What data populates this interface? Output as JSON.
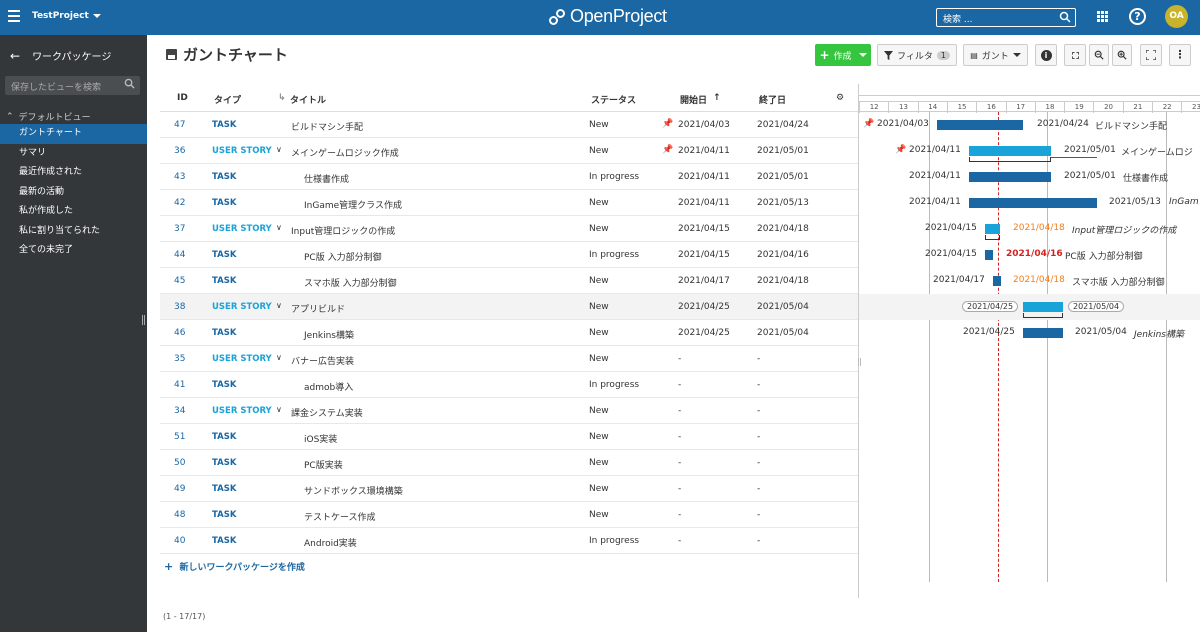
{
  "header": {
    "project": "TestProject",
    "logo": "OpenProject",
    "search_placeholder": "検索 ...",
    "avatar": "OA",
    "brand_color": "#1a67a3"
  },
  "sidebar": {
    "back_label": "ワークパッケージ",
    "search_placeholder": "保存したビューを検索",
    "section": "デフォルトビュー",
    "items": [
      {
        "label": "ガントチャート"
      },
      {
        "label": "サマリ"
      },
      {
        "label": "最近作成された"
      },
      {
        "label": "最新の活動"
      },
      {
        "label": "私が作成した"
      },
      {
        "label": "私に割り当てられた"
      },
      {
        "label": "全ての未完了"
      }
    ]
  },
  "page": {
    "title": "ガントチャート",
    "create": "作成",
    "filter": "フィルタ",
    "filter_count": "1",
    "gantt": "ガント"
  },
  "table": {
    "headers": {
      "id": "ID",
      "type": "タイプ",
      "title": "タイトル",
      "status": "ステータス",
      "start": "開始日",
      "end": "終了日"
    },
    "rows": [
      {
        "id": "47",
        "type": "TASK",
        "title": "ビルドマシン手配",
        "indent": 0,
        "status": "New",
        "start": "2021/04/03",
        "end": "2021/04/24"
      },
      {
        "id": "36",
        "type": "USER STORY",
        "title": "メインゲームロジック作成",
        "indent": 0,
        "status": "New",
        "start": "2021/04/11",
        "end": "2021/05/01"
      },
      {
        "id": "43",
        "type": "TASK",
        "title": "仕様書作成",
        "indent": 1,
        "status": "In progress",
        "start": "2021/04/11",
        "end": "2021/05/01"
      },
      {
        "id": "42",
        "type": "TASK",
        "title": "InGame管理クラス作成",
        "indent": 1,
        "status": "New",
        "start": "2021/04/11",
        "end": "2021/05/13"
      },
      {
        "id": "37",
        "type": "USER STORY",
        "title": "Input管理ロジックの作成",
        "indent": 0,
        "status": "New",
        "start": "2021/04/15",
        "end": "2021/04/18"
      },
      {
        "id": "44",
        "type": "TASK",
        "title": "PC版 入力部分制御",
        "indent": 1,
        "status": "In progress",
        "start": "2021/04/15",
        "end": "2021/04/16"
      },
      {
        "id": "45",
        "type": "TASK",
        "title": "スマホ版 入力部分制御",
        "indent": 1,
        "status": "New",
        "start": "2021/04/17",
        "end": "2021/04/18"
      },
      {
        "id": "38",
        "type": "USER STORY",
        "title": "アプリビルド",
        "indent": 0,
        "status": "New",
        "start": "2021/04/25",
        "end": "2021/05/04"
      },
      {
        "id": "46",
        "type": "TASK",
        "title": "Jenkins構築",
        "indent": 1,
        "status": "New",
        "start": "2021/04/25",
        "end": "2021/05/04"
      },
      {
        "id": "35",
        "type": "USER STORY",
        "title": "バナー広告実装",
        "indent": 0,
        "status": "New",
        "start": "-",
        "end": "-"
      },
      {
        "id": "41",
        "type": "TASK",
        "title": "admob導入",
        "indent": 1,
        "status": "In progress",
        "start": "-",
        "end": "-"
      },
      {
        "id": "34",
        "type": "USER STORY",
        "title": "課金システム実装",
        "indent": 0,
        "status": "New",
        "start": "-",
        "end": "-"
      },
      {
        "id": "51",
        "type": "TASK",
        "title": "iOS実装",
        "indent": 1,
        "status": "New",
        "start": "-",
        "end": "-"
      },
      {
        "id": "50",
        "type": "TASK",
        "title": "PC版実装",
        "indent": 1,
        "status": "New",
        "start": "-",
        "end": "-"
      },
      {
        "id": "49",
        "type": "TASK",
        "title": "サンドボックス環境構築",
        "indent": 1,
        "status": "New",
        "start": "-",
        "end": "-"
      },
      {
        "id": "48",
        "type": "TASK",
        "title": "テストケース作成",
        "indent": 1,
        "status": "New",
        "start": "-",
        "end": "-"
      },
      {
        "id": "40",
        "type": "TASK",
        "title": "Android実装",
        "indent": 1,
        "status": "In progress",
        "start": "-",
        "end": "-"
      }
    ],
    "new_row": "新しいワークパッケージを作成",
    "pager": "(1 - 17/17)"
  },
  "gantt": {
    "days": [
      "12",
      "13",
      "14",
      "15",
      "16",
      "17",
      "18",
      "19",
      "20",
      "21",
      "22",
      "23"
    ],
    "today_day": "17",
    "labels": {
      "r0_start": "2021/04/03",
      "r0_end": "2021/04/24",
      "r0_name": "ビルドマシン手配",
      "r1_start": "2021/04/11",
      "r1_end": "2021/05/01",
      "r1_name": "メインゲームロジ",
      "r2_start": "2021/04/11",
      "r2_end": "2021/05/01",
      "r2_name": "仕様書作成",
      "r3_start": "2021/04/11",
      "r3_end": "2021/05/13",
      "r3_name": "InGam",
      "r4_start": "2021/04/15",
      "r4_end": "2021/04/18",
      "r4_name": "Input管理ロジックの作成",
      "r5_start": "2021/04/15",
      "r5_end": "2021/04/16",
      "r5_name": "PC版 入力部分制御",
      "r6_start": "2021/04/17",
      "r6_end": "2021/04/18",
      "r6_name": "スマホ版 入力部分制御",
      "r7_start": "2021/04/25",
      "r7_end": "2021/05/04",
      "r8_start": "2021/04/25",
      "r8_end": "2021/05/04",
      "r8_name": "Jenkins構築"
    }
  }
}
